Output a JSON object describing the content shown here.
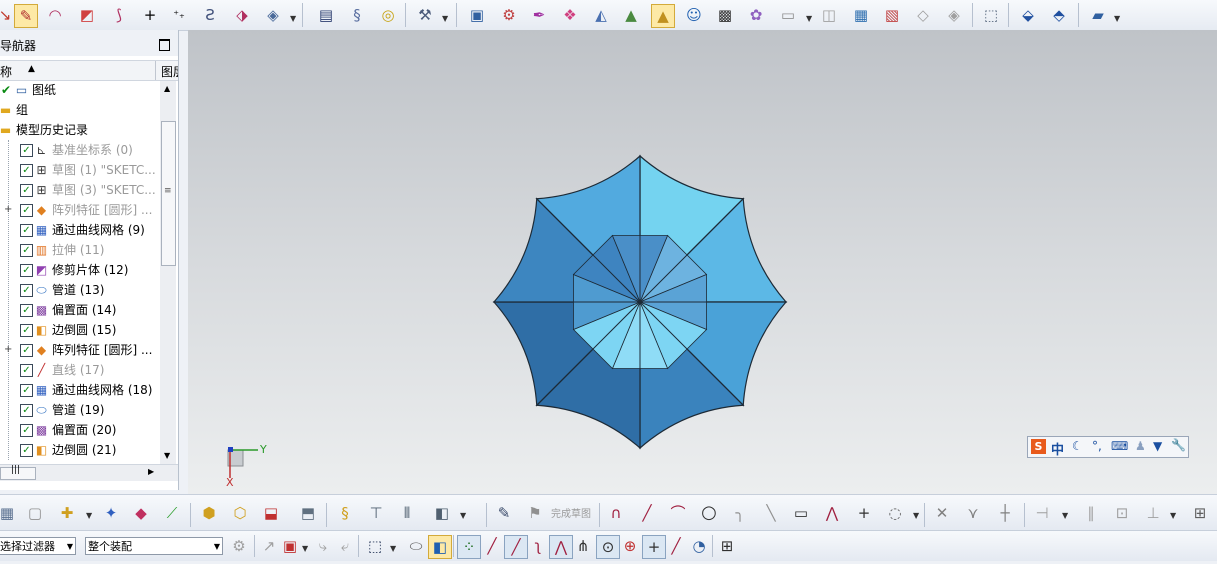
{
  "navigator": {
    "title": "部件导航器",
    "header": {
      "name_col": "名称",
      "sort_icon": "sort-ascending-icon",
      "col2": "图层"
    },
    "items": [
      {
        "label": "图纸",
        "checked": true,
        "icon": "drawing-sheet-icon",
        "depth": 0,
        "greyed": false
      },
      {
        "label": "组",
        "checked": false,
        "icon": "folder-icon",
        "depth": 0,
        "greyed": false
      },
      {
        "label": "模型历史记录",
        "checked": false,
        "icon": "folder-icon",
        "depth": 0,
        "greyed": false
      },
      {
        "label": "基准坐标系 (0)",
        "checked": true,
        "icon": "datum-csys-icon",
        "depth": 1,
        "greyed": true
      },
      {
        "label": "草图 (1) \"SKETC...",
        "checked": true,
        "icon": "sketch-icon",
        "depth": 1,
        "greyed": true
      },
      {
        "label": "草图 (3) \"SKETC...",
        "checked": true,
        "icon": "sketch-icon",
        "depth": 1,
        "greyed": true
      },
      {
        "label": "阵列特征 [圆形] ...",
        "checked": true,
        "icon": "pattern-feature-icon",
        "depth": 1,
        "greyed": true,
        "expandable": true
      },
      {
        "label": "通过曲线网格 (9)",
        "checked": true,
        "icon": "through-curve-mesh-icon",
        "depth": 1,
        "greyed": false
      },
      {
        "label": "拉伸 (11)",
        "checked": true,
        "icon": "extrude-icon",
        "depth": 1,
        "greyed": true
      },
      {
        "label": "修剪片体 (12)",
        "checked": true,
        "icon": "trim-sheet-icon",
        "depth": 1,
        "greyed": false
      },
      {
        "label": "管道 (13)",
        "checked": true,
        "icon": "tube-icon",
        "depth": 1,
        "greyed": false
      },
      {
        "label": "偏置面 (14)",
        "checked": true,
        "icon": "offset-face-icon",
        "depth": 1,
        "greyed": false
      },
      {
        "label": "边倒圆 (15)",
        "checked": true,
        "icon": "edge-blend-icon",
        "depth": 1,
        "greyed": false
      },
      {
        "label": "阵列特征 [圆形] ...",
        "checked": true,
        "icon": "pattern-feature-icon",
        "depth": 1,
        "greyed": false,
        "expandable": true
      },
      {
        "label": "直线 (17)",
        "checked": true,
        "icon": "line-icon",
        "depth": 1,
        "greyed": true
      },
      {
        "label": "通过曲线网格 (18)",
        "checked": true,
        "icon": "through-curve-mesh-icon",
        "depth": 1,
        "greyed": false
      },
      {
        "label": "管道 (19)",
        "checked": true,
        "icon": "tube-icon",
        "depth": 1,
        "greyed": false
      },
      {
        "label": "偏置面 (20)",
        "checked": true,
        "icon": "offset-face-icon",
        "depth": 1,
        "greyed": false
      },
      {
        "label": "边倒圆 (21)",
        "checked": true,
        "icon": "edge-blend-icon",
        "depth": 1,
        "greyed": false
      }
    ]
  },
  "viewport": {
    "triad": {
      "x_label": "X",
      "y_label": "Y"
    },
    "model": "umbrella-octagon-model",
    "input_indicator": {
      "label": "中",
      "icons": [
        "sogou-s-icon",
        "moon-icon",
        "punctuation-icon",
        "keyboard-icon",
        "user-icon",
        "shirt-icon",
        "wrench-icon"
      ]
    }
  },
  "top_toolbar": {
    "icons": [
      "sketch-curve-icon",
      "profile-icon",
      "studio-spline-icon",
      "surface-icon",
      "point-icon",
      "point-set-icon",
      "offset-curve-icon",
      "project-curve-icon",
      "bridge-curve-icon",
      "rebuild-icon",
      "helix-icon",
      "spring-icon",
      "coil-icon",
      "render-icon",
      "camera-icon",
      "paint-icon",
      "palette-icon",
      "material-icon",
      "lamp-icon",
      "highlight-icon",
      "user-icon",
      "photo-icon",
      "color-icon",
      "save-view-icon",
      "box-icon",
      "cube-icon",
      "image-icon",
      "layer-icon",
      "wireframe-icon",
      "select-box-icon",
      "move-icon",
      "transform-icon",
      "settings-icon"
    ]
  },
  "bottom_toolbar": {
    "finish_sketch_label": "完成草图"
  },
  "filter_bar": {
    "type_filter": "无选择过滤器",
    "scope_filter": "整个装配"
  },
  "colors": {
    "model_light": "#7fd8f2",
    "model_mid": "#4a9fd8",
    "model_dark": "#2e6ea8",
    "check_green": "#0a8a12",
    "viewport_top": "#bfc3c8",
    "viewport_bottom": "#eceeef"
  }
}
